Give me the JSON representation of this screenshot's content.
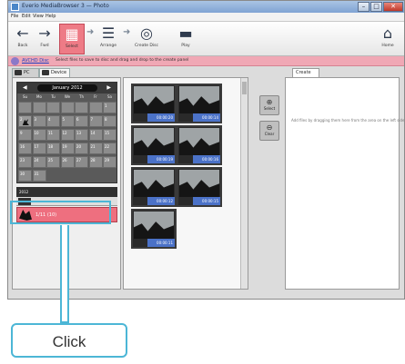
{
  "window": {
    "title": "Everio MediaBrowser 3 — Photo",
    "controls": {
      "minimize": "–",
      "maximize": "□",
      "close": "✕"
    }
  },
  "menu": [
    "File",
    "Edit",
    "View",
    "Help"
  ],
  "toolbar": {
    "tools": [
      {
        "id": "back",
        "label": "Back",
        "icon": "back-arrow-icon"
      },
      {
        "id": "fwd",
        "label": "Fwd",
        "icon": "forward-arrow-icon"
      },
      {
        "id": "select",
        "label": "Select",
        "icon": "select-icon",
        "active": true
      },
      {
        "id": "arrange",
        "label": "Arrange",
        "icon": "list-icon"
      },
      {
        "id": "create",
        "label": "Create Disc",
        "icon": "disc-icon"
      },
      {
        "id": "play",
        "label": "Play",
        "icon": "film-icon"
      }
    ],
    "home_label": "Home"
  },
  "banner": {
    "link": "AVCHD Disc",
    "text": "Select files to save to disc and drag and drop to the create panel"
  },
  "tabs": {
    "pc": "PC",
    "device": "Device"
  },
  "calendar": {
    "month": "January 2012",
    "prev": "◀",
    "next": "▶",
    "weekdays": [
      "Su",
      "Mo",
      "Tu",
      "We",
      "Th",
      "Fr",
      "Sa"
    ],
    "days": [
      "",
      "",
      "",
      "",
      "",
      "",
      "1",
      "2",
      "3",
      "4",
      "5",
      "6",
      "7",
      "8",
      "9",
      "10",
      "11",
      "12",
      "13",
      "14",
      "15",
      "16",
      "17",
      "18",
      "19",
      "20",
      "21",
      "22",
      "23",
      "24",
      "25",
      "26",
      "27",
      "28",
      "29",
      "30",
      "31"
    ],
    "photo_days": [
      "2"
    ]
  },
  "list": {
    "header": "2012",
    "selected_label": "1/11 (10)"
  },
  "thumbnails": [
    {
      "duration": "00:00:20"
    },
    {
      "duration": "00:00:14"
    },
    {
      "duration": "00:00:19"
    },
    {
      "duration": "00:00:16"
    },
    {
      "duration": "00:00:12"
    },
    {
      "duration": "00:00:15"
    },
    {
      "duration": "00:00:11"
    }
  ],
  "side_buttons": [
    {
      "label": "Select",
      "icon": "select-icon"
    },
    {
      "label": "Clear",
      "icon": "clear-icon"
    }
  ],
  "create_panel": {
    "tab": "Create",
    "message": "Add files by dragging them here from the area on the left side"
  },
  "callout": {
    "label": "Click",
    "color": "#4cb6d6"
  },
  "colors": {
    "accent": "#ee6f7f",
    "banner": "#f0a8b5",
    "duration": "#4b72c8"
  }
}
